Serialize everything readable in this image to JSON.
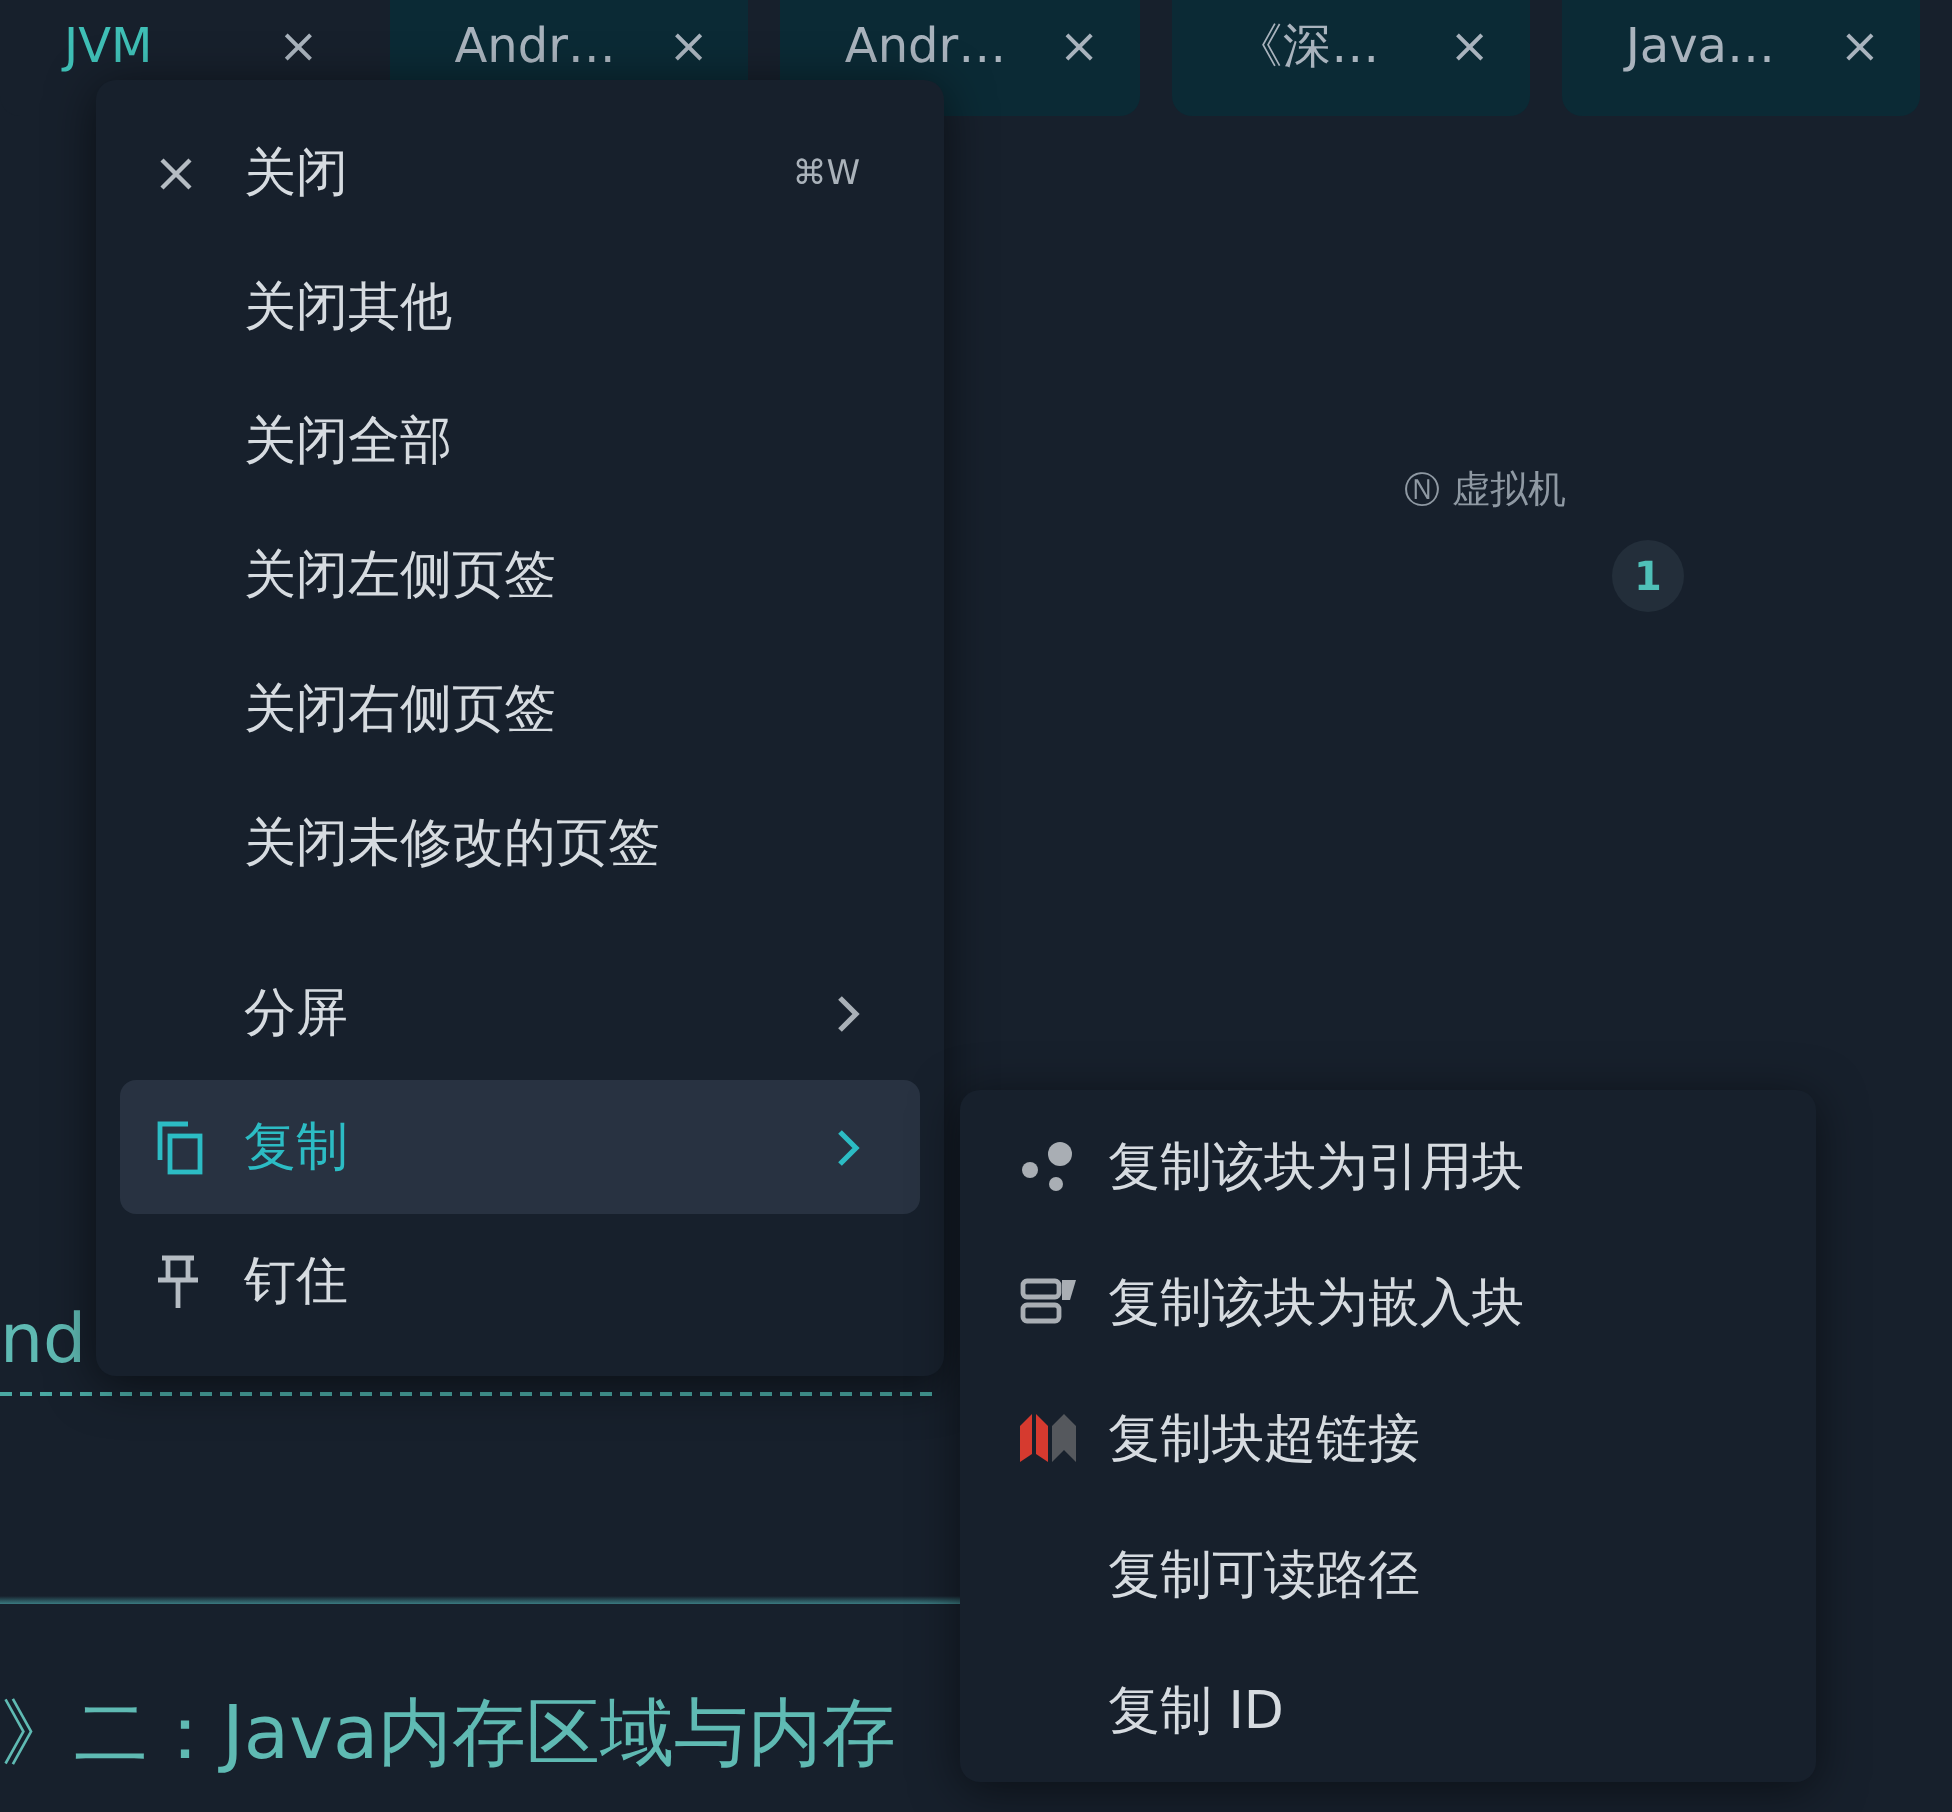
{
  "tabs": [
    {
      "label": "JVM",
      "selected": true,
      "close": "×"
    },
    {
      "label": "Andr…",
      "selected": false,
      "close": "×"
    },
    {
      "label": "Andr…",
      "selected": false,
      "close": "×"
    },
    {
      "label": "《深…",
      "selected": false,
      "close": "×"
    },
    {
      "label": "Java…",
      "selected": false,
      "close": "×"
    }
  ],
  "outline": {
    "marker": "Ⓝ",
    "label": "虚拟机",
    "count": "1"
  },
  "content": {
    "fragment": "nd",
    "heading": "》二：Java内存区域与内存"
  },
  "context_menu": {
    "items": [
      {
        "label": "关闭",
        "shortcut": "⌘W",
        "submenu": false,
        "selected": false
      },
      {
        "label": "关闭其他",
        "submenu": false,
        "selected": false
      },
      {
        "label": "关闭全部",
        "submenu": false,
        "selected": false
      },
      {
        "label": "关闭左侧页签",
        "submenu": false,
        "selected": false
      },
      {
        "label": "关闭右侧页签",
        "submenu": false,
        "selected": false
      },
      {
        "label": "关闭未修改的页签",
        "submenu": false,
        "selected": false
      },
      {
        "label": "分屏",
        "submenu": true,
        "selected": false
      },
      {
        "label": "复制",
        "submenu": true,
        "selected": true
      },
      {
        "label": "钉住",
        "submenu": false,
        "selected": false
      }
    ]
  },
  "copy_submenu": {
    "items": [
      {
        "label": "复制该块为引用块"
      },
      {
        "label": "复制该块为嵌入块"
      },
      {
        "label": "复制块超链接"
      },
      {
        "label": "复制可读路径"
      },
      {
        "label": "复制 ID"
      }
    ]
  }
}
